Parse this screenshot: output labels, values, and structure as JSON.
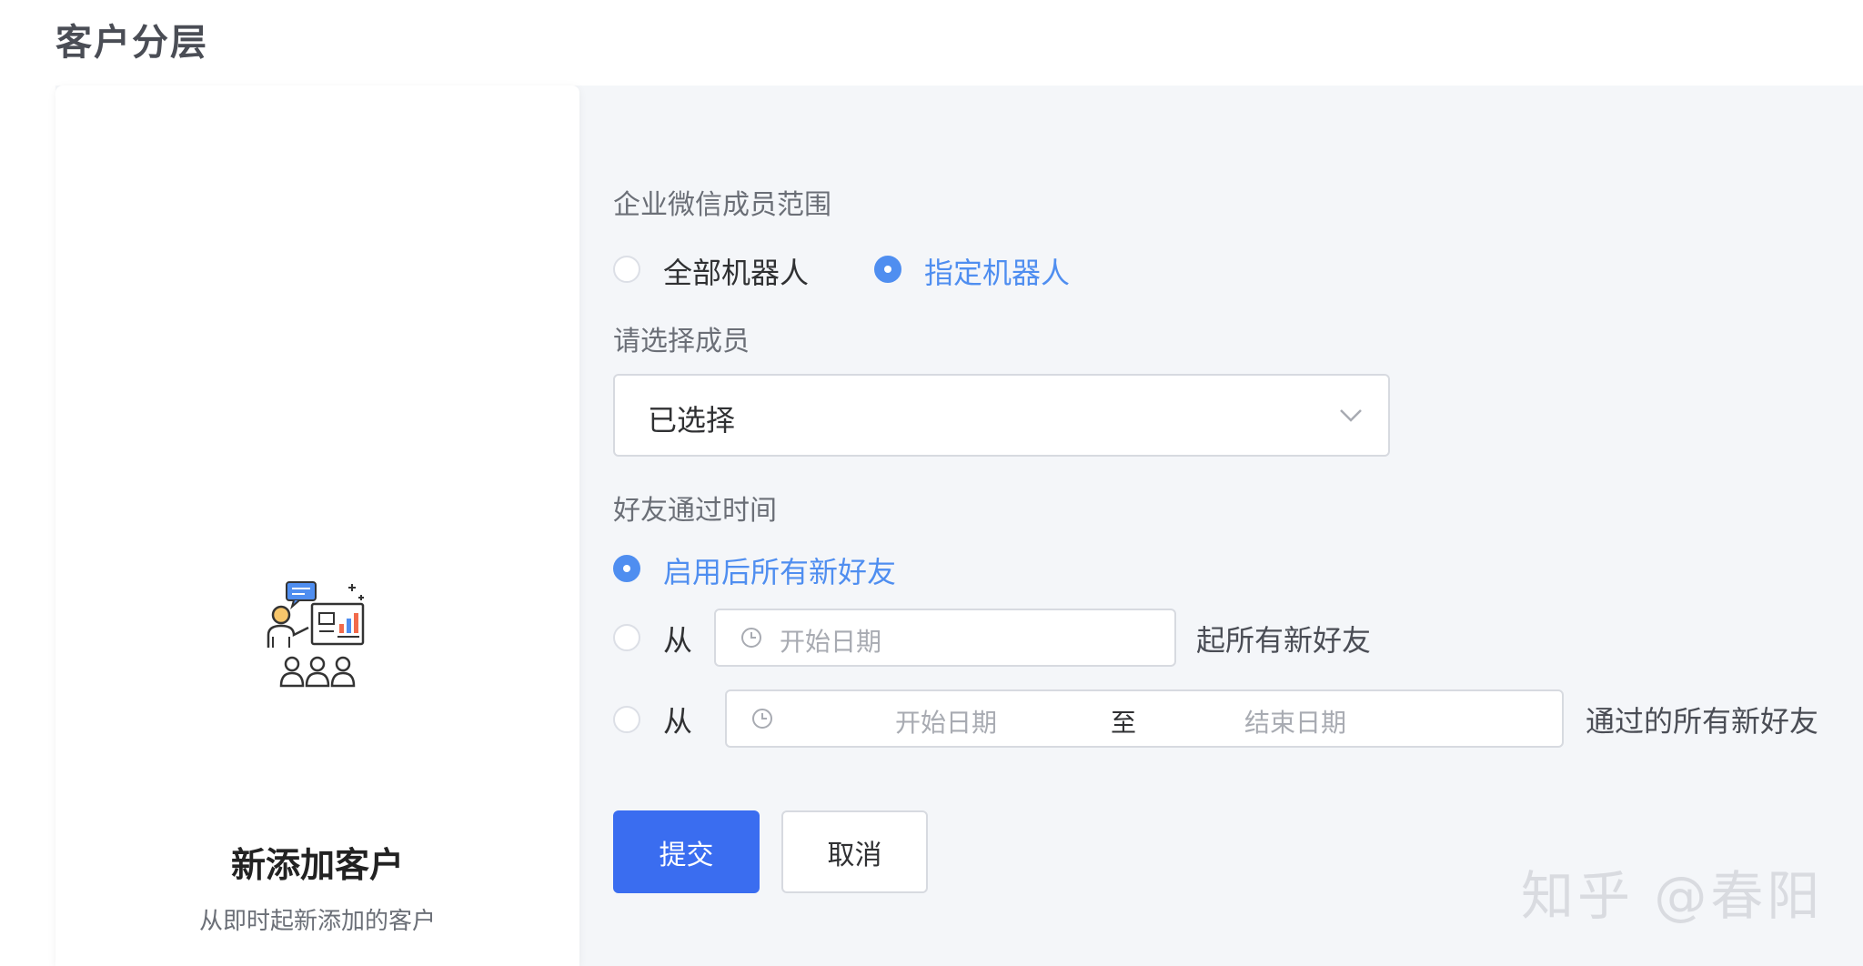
{
  "page": {
    "title": "客户分层"
  },
  "card": {
    "title": "新添加客户",
    "description": "从即时起新添加的客户",
    "illustration_icon": "presentation-audience-icon"
  },
  "form": {
    "scope_label": "企业微信成员范围",
    "scope_options": [
      {
        "label": "全部机器人",
        "checked": false
      },
      {
        "label": "指定机器人",
        "checked": true
      }
    ],
    "member_label": "请选择成员",
    "member_select_value": "已选择",
    "friend_time_label": "好友通过时间",
    "friend_options": {
      "all_after_enable": {
        "label": "启用后所有新好友",
        "checked": true
      },
      "from_date": {
        "prefix": "从",
        "start_placeholder": "开始日期",
        "suffix": "起所有新好友",
        "checked": false
      },
      "date_range": {
        "prefix": "从",
        "start_placeholder": "开始日期",
        "separator": "至",
        "end_placeholder": "结束日期",
        "suffix": "通过的所有新好友",
        "checked": false
      }
    },
    "submit_label": "提交",
    "cancel_label": "取消"
  },
  "watermark": "知乎 @春阳",
  "colors": {
    "primary": "#3a6df0",
    "active_radio": "#4f8ef0",
    "background": "#f4f6f9"
  }
}
